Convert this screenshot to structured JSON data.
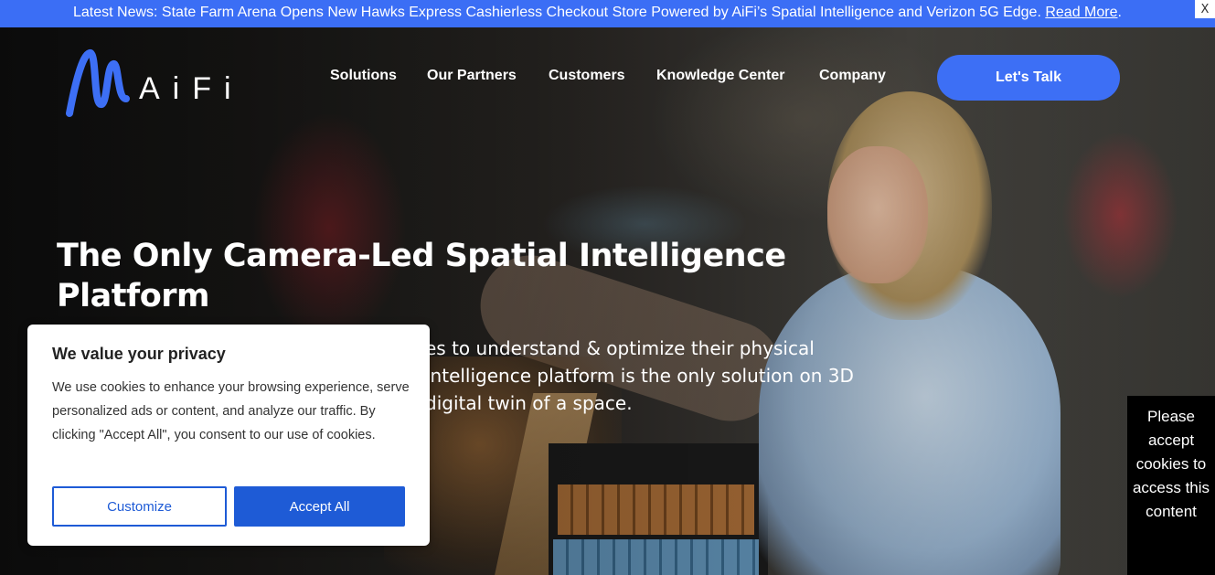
{
  "news_bar": {
    "text": "Latest News: State Farm Arena Opens New Hawks Express Cashierless Checkout Store Powered by AiFi’s Spatial Intelligence and Verizon 5G Edge. ",
    "link_label": "Read More",
    "suffix": ".",
    "close_label": "X"
  },
  "header": {
    "logo_text": "AiFi",
    "nav": [
      "Solutions",
      "Our Partners",
      "Customers",
      "Knowledge Center",
      "Company"
    ],
    "cta_label": "Let's Talk"
  },
  "hero": {
    "title": "The Only Camera-Led Spatial Intelligence Platform",
    "subtitle_visible": "es to understand & optimize their physical intelligence platform is the only solution on 3D digital twin of a space."
  },
  "cookie_dialog": {
    "title": "We value your privacy",
    "body": "We use cookies to enhance your browsing experience, serve personalized ads or content, and analyze our traffic. By clicking \"Accept All\", you consent to our use of cookies.",
    "customize_label": "Customize",
    "accept_label": "Accept All"
  },
  "side_note": {
    "text": "Please accept cookies to access this content"
  },
  "colors": {
    "news_bar_bg": "#3b6ef5",
    "cta_bg": "#3d6ff5",
    "cookie_primary": "#1e5bd6",
    "logo_accent": "#3d6ff5"
  },
  "icons": {
    "logo_mark": "aifi-wave-logo",
    "close": "close-icon"
  }
}
